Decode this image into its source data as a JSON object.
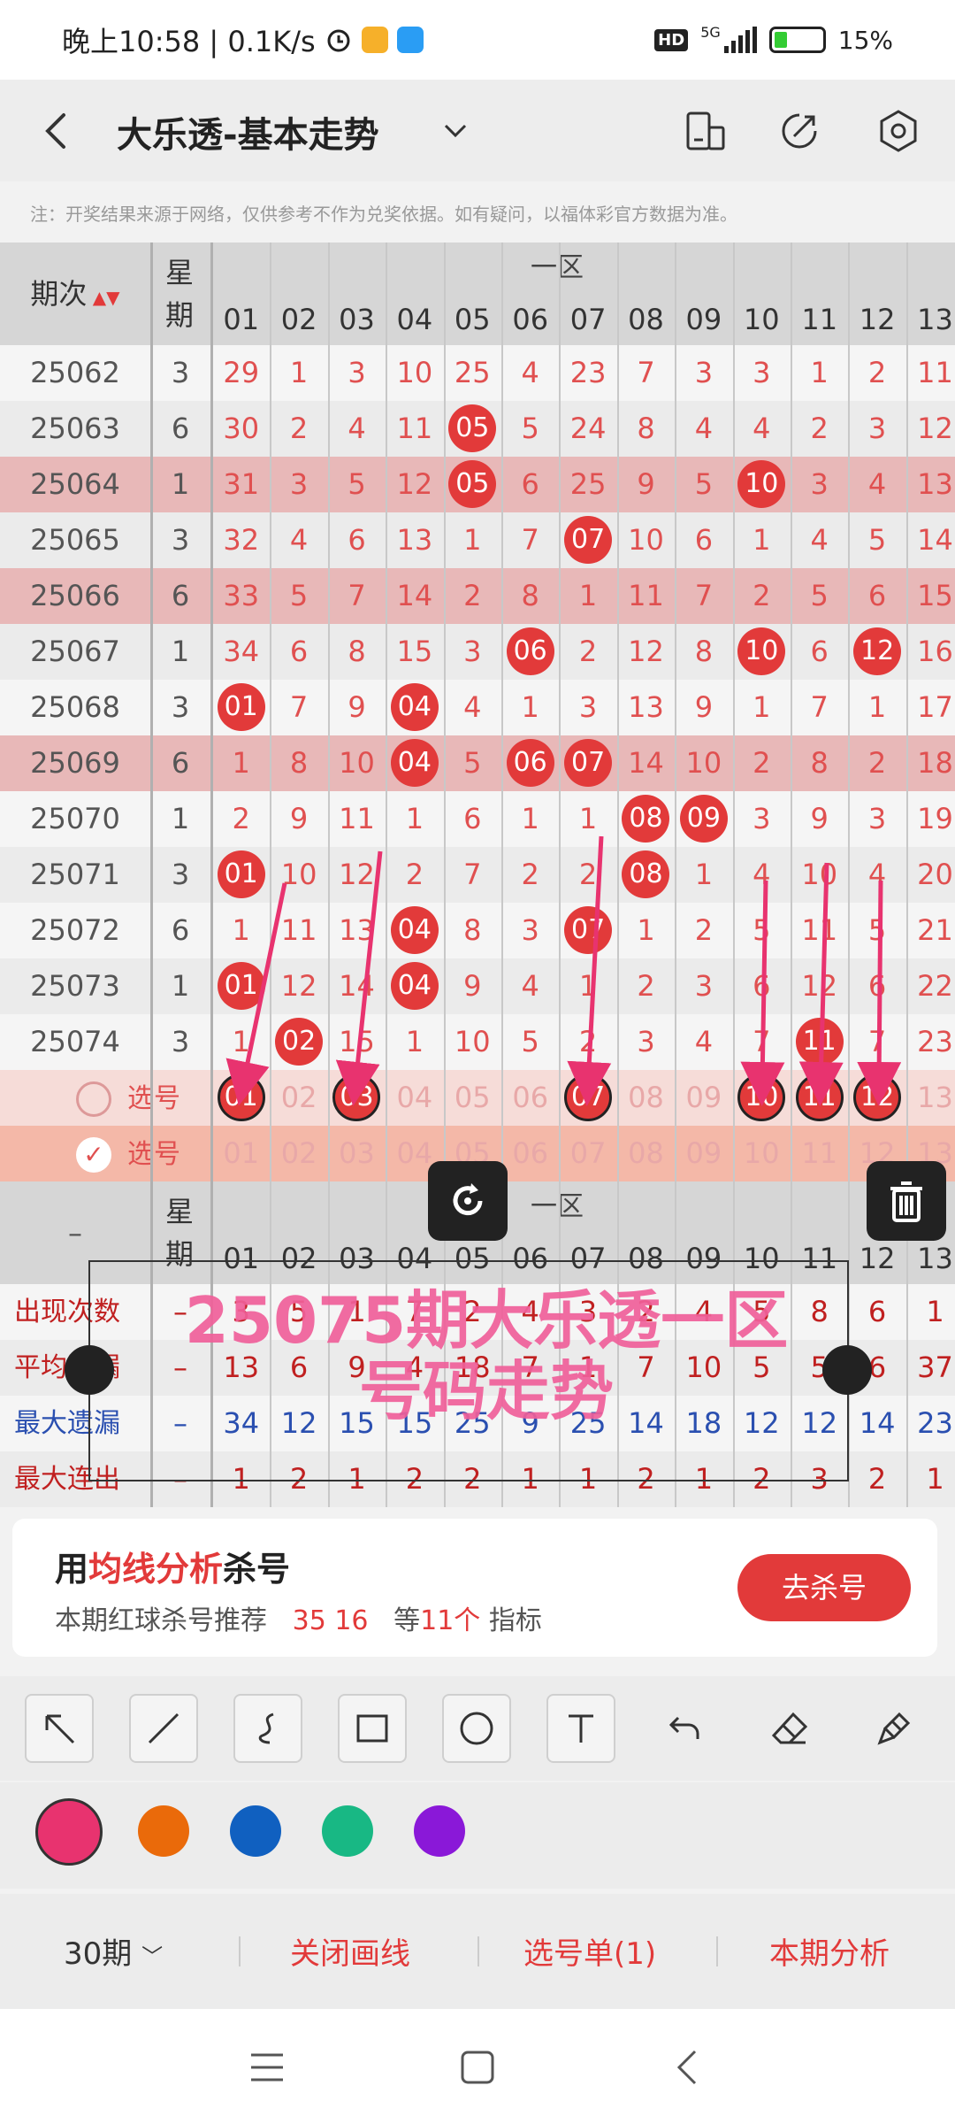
{
  "status": {
    "time": "晚上10:58 | 0.1K/s",
    "network": "5G",
    "hd": "HD",
    "battery": "15%"
  },
  "header": {
    "title": "大乐透-基本走势"
  },
  "notice": "注：开奖结果来源于网络，仅供参考不作为兑奖依据。如有疑问，以福体彩官方数据为准。",
  "table": {
    "col_period": "期次",
    "col_week": "星期",
    "zone": "一区",
    "numbers": [
      "01",
      "02",
      "03",
      "04",
      "05",
      "06",
      "07",
      "08",
      "09",
      "10",
      "11",
      "12",
      "13"
    ],
    "rows": [
      {
        "p": "25062",
        "w": "3",
        "v": [
          "29",
          "1",
          "3",
          "10",
          "25",
          "4",
          "23",
          "7",
          "3",
          "3",
          "1",
          "2",
          "11"
        ],
        "hit": []
      },
      {
        "p": "25063",
        "w": "6",
        "v": [
          "30",
          "2",
          "4",
          "11",
          "05",
          "5",
          "24",
          "8",
          "4",
          "4",
          "2",
          "3",
          "12"
        ],
        "hit": [
          4
        ]
      },
      {
        "p": "25064",
        "w": "1",
        "v": [
          "31",
          "3",
          "5",
          "12",
          "05",
          "6",
          "25",
          "9",
          "5",
          "10",
          "3",
          "4",
          "13"
        ],
        "hit": [
          4,
          9
        ],
        "hl": true
      },
      {
        "p": "25065",
        "w": "3",
        "v": [
          "32",
          "4",
          "6",
          "13",
          "1",
          "7",
          "07",
          "10",
          "6",
          "1",
          "4",
          "5",
          "14"
        ],
        "hit": [
          6
        ]
      },
      {
        "p": "25066",
        "w": "6",
        "v": [
          "33",
          "5",
          "7",
          "14",
          "2",
          "8",
          "1",
          "11",
          "7",
          "2",
          "5",
          "6",
          "15"
        ],
        "hit": [],
        "hl": true
      },
      {
        "p": "25067",
        "w": "1",
        "v": [
          "34",
          "6",
          "8",
          "15",
          "3",
          "06",
          "2",
          "12",
          "8",
          "10",
          "6",
          "12",
          "16"
        ],
        "hit": [
          5,
          9,
          11
        ]
      },
      {
        "p": "25068",
        "w": "3",
        "v": [
          "01",
          "7",
          "9",
          "04",
          "4",
          "1",
          "3",
          "13",
          "9",
          "1",
          "7",
          "1",
          "17"
        ],
        "hit": [
          0,
          3
        ]
      },
      {
        "p": "25069",
        "w": "6",
        "v": [
          "1",
          "8",
          "10",
          "04",
          "5",
          "06",
          "07",
          "14",
          "10",
          "2",
          "8",
          "2",
          "18"
        ],
        "hit": [
          3,
          5,
          6
        ],
        "hl": true
      },
      {
        "p": "25070",
        "w": "1",
        "v": [
          "2",
          "9",
          "11",
          "1",
          "6",
          "1",
          "1",
          "08",
          "09",
          "3",
          "9",
          "3",
          "19"
        ],
        "hit": [
          7,
          8
        ]
      },
      {
        "p": "25071",
        "w": "3",
        "v": [
          "01",
          "10",
          "12",
          "2",
          "7",
          "2",
          "2",
          "08",
          "1",
          "4",
          "10",
          "4",
          "20"
        ],
        "hit": [
          0,
          7
        ]
      },
      {
        "p": "25072",
        "w": "6",
        "v": [
          "1",
          "11",
          "13",
          "04",
          "8",
          "3",
          "07",
          "1",
          "2",
          "5",
          "11",
          "5",
          "21"
        ],
        "hit": [
          3,
          6
        ]
      },
      {
        "p": "25073",
        "w": "1",
        "v": [
          "01",
          "12",
          "14",
          "04",
          "9",
          "4",
          "1",
          "2",
          "3",
          "6",
          "12",
          "6",
          "22"
        ],
        "hit": [
          0,
          3
        ]
      },
      {
        "p": "25074",
        "w": "3",
        "v": [
          "1",
          "02",
          "15",
          "1",
          "10",
          "5",
          "2",
          "3",
          "4",
          "7",
          "11",
          "7",
          "23"
        ],
        "hit": [
          1,
          10
        ]
      }
    ],
    "select_label": "选号",
    "select_rows": [
      {
        "hit": [
          0,
          2,
          6,
          9,
          10,
          11
        ]
      },
      {
        "hit": []
      }
    ],
    "stats": [
      {
        "label": "出现次数",
        "w": "–",
        "v": [
          "3",
          "5",
          "1",
          "7",
          "2",
          "4",
          "3",
          "2",
          "4",
          "5",
          "8",
          "6",
          "1"
        ],
        "color": "#c02020"
      },
      {
        "label": "平均遗漏",
        "w": "–",
        "v": [
          "13",
          "6",
          "9",
          "4",
          "18",
          "7",
          "1",
          "7",
          "10",
          "5",
          "5",
          "6",
          "37"
        ],
        "color": "#c02020"
      },
      {
        "label": "最大遗漏",
        "w": "–",
        "v": [
          "34",
          "12",
          "15",
          "15",
          "25",
          "9",
          "25",
          "14",
          "18",
          "12",
          "12",
          "14",
          "23"
        ],
        "color": "#2a4fb0"
      },
      {
        "label": "最大连出",
        "w": "–",
        "v": [
          "1",
          "2",
          "1",
          "2",
          "2",
          "1",
          "1",
          "2",
          "1",
          "2",
          "3",
          "2",
          "1"
        ],
        "color": "#c02020"
      }
    ]
  },
  "overlay": {
    "line1": "25075期大乐透一区",
    "line2": "号码走势"
  },
  "recommend": {
    "t_prefix": "用",
    "t_accent": "均线分析",
    "t_suffix": "杀号",
    "sub_prefix": "本期红球杀号推荐",
    "sub_nums": "35 16",
    "sub_mid": "等",
    "sub_count": "11个",
    "sub_suffix": "指标",
    "button": "去杀号"
  },
  "colors": [
    "#e8336f",
    "#ea6a0a",
    "#1060c0",
    "#18b884",
    "#8a18d8"
  ],
  "bottom": {
    "period": "30期",
    "close": "关闭画线",
    "list": "选号单(1)",
    "analysis": "本期分析"
  }
}
